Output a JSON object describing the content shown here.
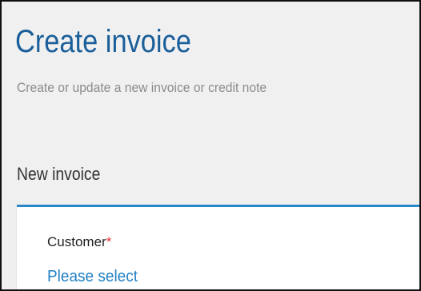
{
  "header": {
    "title": "Create invoice",
    "subtitle": "Create or update a new invoice or credit note"
  },
  "section": {
    "title": "New invoice"
  },
  "form": {
    "customer": {
      "label": "Customer",
      "required_mark": "*",
      "value_link": "Please select"
    }
  },
  "colors": {
    "title": "#1b5f9a",
    "subtitle": "#8c8c8c",
    "background": "#f0f0f0",
    "card_accent": "#2b88c8",
    "link": "#1f7fc4",
    "required": "#e53935"
  }
}
